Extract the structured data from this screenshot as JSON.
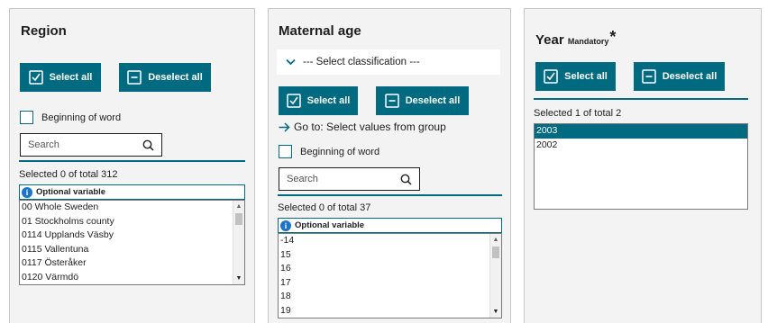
{
  "region": {
    "title": "Region",
    "select_all": "Select all",
    "deselect_all": "Deselect all",
    "beginning_of_word": "Beginning of word",
    "search_placeholder": "Search",
    "selected_count": "Selected 0 of total 312",
    "optional_variable": "Optional variable",
    "items": [
      "00 Whole Sweden",
      "01 Stockholms county",
      "0114 Upplands Väsby",
      "0115 Vallentuna",
      "0117 Österåker",
      "0120 Värmdö"
    ]
  },
  "maternal_age": {
    "title": "Maternal age",
    "classification_placeholder": "--- Select classification ---",
    "select_all": "Select all",
    "deselect_all": "Deselect all",
    "goto_link": "Go to: Select values from group",
    "beginning_of_word": "Beginning of word",
    "search_placeholder": "Search",
    "selected_count": "Selected 0 of total 37",
    "optional_variable": "Optional variable",
    "items": [
      "-14",
      "15",
      "16",
      "17",
      "18",
      "19"
    ]
  },
  "year": {
    "title": "Year",
    "mandatory": "Mandatory",
    "star": "*",
    "select_all": "Select all",
    "deselect_all": "Deselect all",
    "selected_count": "Selected 1 of total 2",
    "items": [
      "2003",
      "2002"
    ],
    "selected_index": 0
  },
  "colors": {
    "accent": "#006a80",
    "panel_bg": "#f3f3f3",
    "info": "#1b74c9"
  },
  "icons": {
    "select_all": "check-square-icon",
    "deselect_all": "minus-square-icon",
    "search": "search-icon",
    "info": "info-icon",
    "chevron": "chevron-down-icon",
    "arrow": "arrow-right-icon"
  }
}
